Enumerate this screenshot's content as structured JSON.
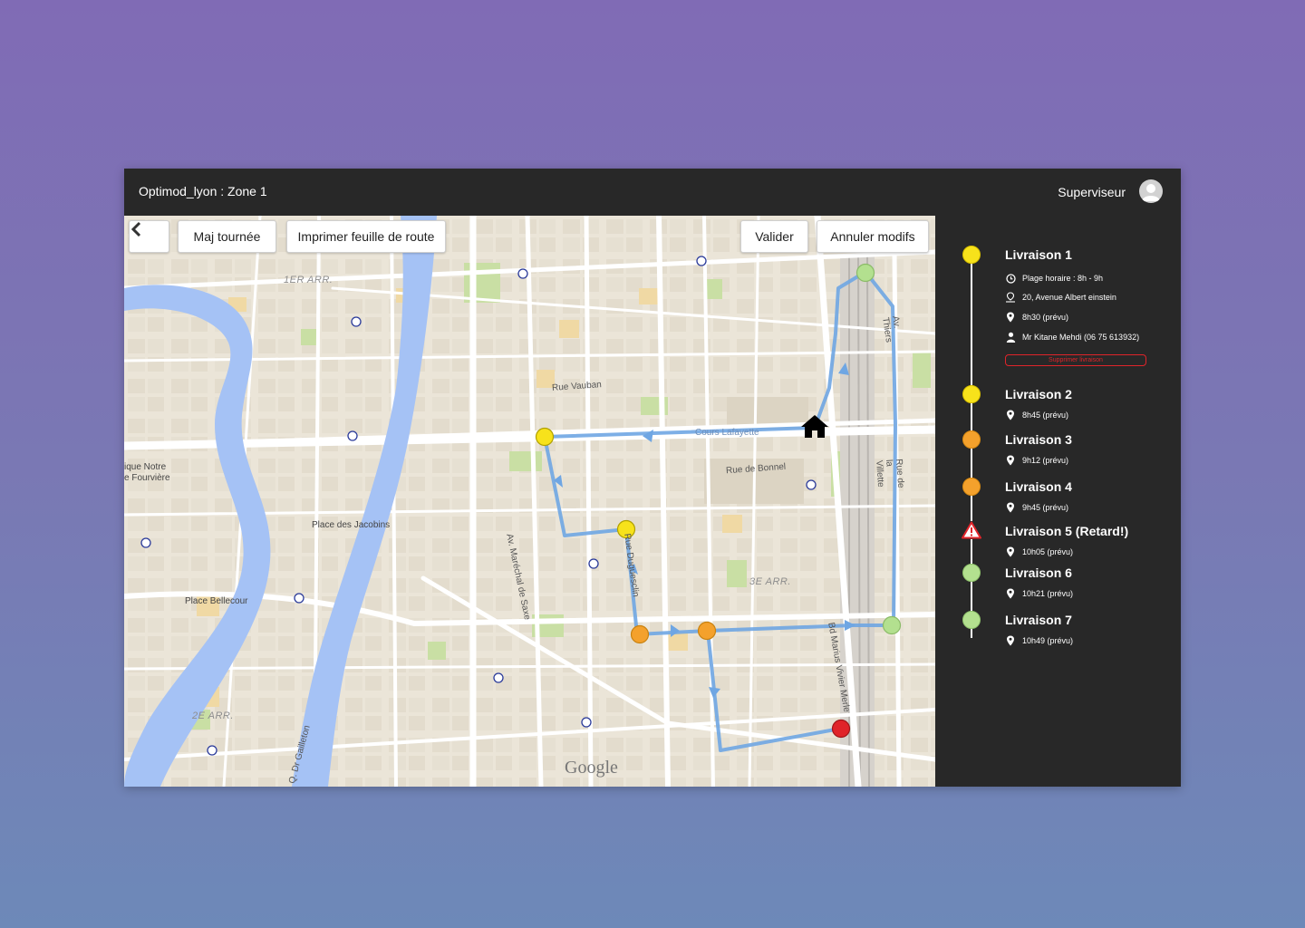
{
  "app_title": "Optimod_lyon : Zone 1",
  "user_label": "Superviseur",
  "toolbar": {
    "maj_label": "Maj tournée",
    "print_label": "Imprimer feuille de route",
    "validate_label": "Valider",
    "cancel_label": "Annuler modifs"
  },
  "colors": {
    "yellow": "#f7e21b",
    "orange": "#f4a12c",
    "green": "#b3e08f",
    "red": "#e0242a",
    "route": "#6fa6e3"
  },
  "map": {
    "labels": {
      "ar1": "1ER ARR.",
      "ar2": "2E ARR.",
      "ar3": "3E ARR.",
      "vauban": "Rue Vauban",
      "lafayette": "Cours Lafayette",
      "bonnel": "Rue de Bonnel",
      "jacobins": "Place des Jacobins",
      "bellecour": "Place Bellecour",
      "fourviere_1": "ique Notre",
      "fourviere_2": "e Fourvière",
      "saxe": "Av. Maréchal de Saxe",
      "duguesclin": "Rue Duguesclin",
      "thiers": "Av. Thiers",
      "villette": "Rue de la Villette",
      "vivier": "Bd Marius Vivier Merle",
      "gailleton": "Q. Dr Gailleton",
      "google": "Google"
    }
  },
  "livraisons": [
    {
      "title": "Livraison 1",
      "status": "yellow",
      "details": [
        {
          "icon": "clock-icon",
          "text": "Plage horaire : 8h  - 9h"
        },
        {
          "icon": "address-icon",
          "text": "20, Avenue Albert einstein"
        },
        {
          "icon": "pin-icon",
          "text": "8h30 (prévu)"
        },
        {
          "icon": "person-icon",
          "text": "Mr Kitane Mehdi (06 75 613932)"
        }
      ],
      "delete_label": "Supprimer livraison"
    },
    {
      "title": "Livraison 2",
      "status": "yellow",
      "details": [
        {
          "icon": "pin-icon",
          "text": "8h45 (prévu)"
        }
      ]
    },
    {
      "title": "Livraison 3",
      "status": "orange",
      "details": [
        {
          "icon": "pin-icon",
          "text": "9h12 (prévu)"
        }
      ]
    },
    {
      "title": "Livraison 4",
      "status": "orange",
      "details": [
        {
          "icon": "pin-icon",
          "text": "9h45 (prévu)"
        }
      ]
    },
    {
      "title": "Livraison 5 (Retard!)",
      "status": "warning",
      "details": [
        {
          "icon": "pin-icon",
          "text": "10h05 (prévu)"
        }
      ]
    },
    {
      "title": "Livraison 6",
      "status": "green",
      "details": [
        {
          "icon": "pin-icon",
          "text": "10h21 (prévu)"
        }
      ]
    },
    {
      "title": "Livraison 7",
      "status": "green",
      "details": [
        {
          "icon": "pin-icon",
          "text": "10h49 (prévu)"
        }
      ]
    }
  ]
}
